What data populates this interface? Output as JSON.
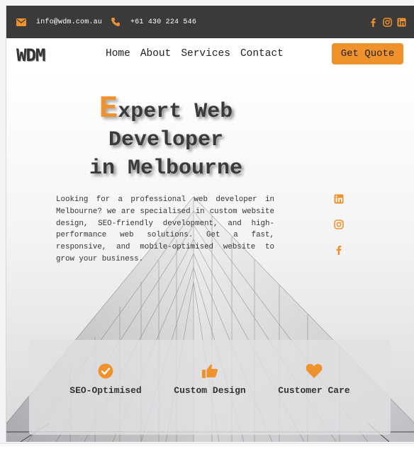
{
  "topbar": {
    "email": "info@wdm.com.au",
    "phone": "+61 430 224 546",
    "icons": [
      "envelope-icon",
      "phone-icon",
      "facebook-icon",
      "instagram-icon",
      "linkedin-icon"
    ]
  },
  "nav": {
    "logo": "WDM",
    "items": [
      "Home",
      "About",
      "Services",
      "Contact"
    ],
    "cta": "Get Quote"
  },
  "hero": {
    "headline_first_letter": "E",
    "headline_line1_rest": "xpert Web",
    "headline_line2": "Developer",
    "headline_line3": "in Melbourne",
    "description": "Looking for a professional web developer in Melbourne? we are specialised in custom website design, SEO-friendly development, and high-performance web solutions. Get a fast, responsive, and mobile-optimised website to grow your business.",
    "side_icons": [
      "linkedin-icon",
      "instagram-icon",
      "facebook-icon"
    ]
  },
  "features": [
    {
      "icon": "check-circle-icon",
      "label": "SEO-Optimised"
    },
    {
      "icon": "thumbs-up-icon",
      "label": "Custom Design"
    },
    {
      "icon": "heart-icon",
      "label": "Customer Care"
    }
  ],
  "colors": {
    "accent": "#f0922c",
    "topbar_bg": "#3a3a3a",
    "text": "#333333"
  }
}
